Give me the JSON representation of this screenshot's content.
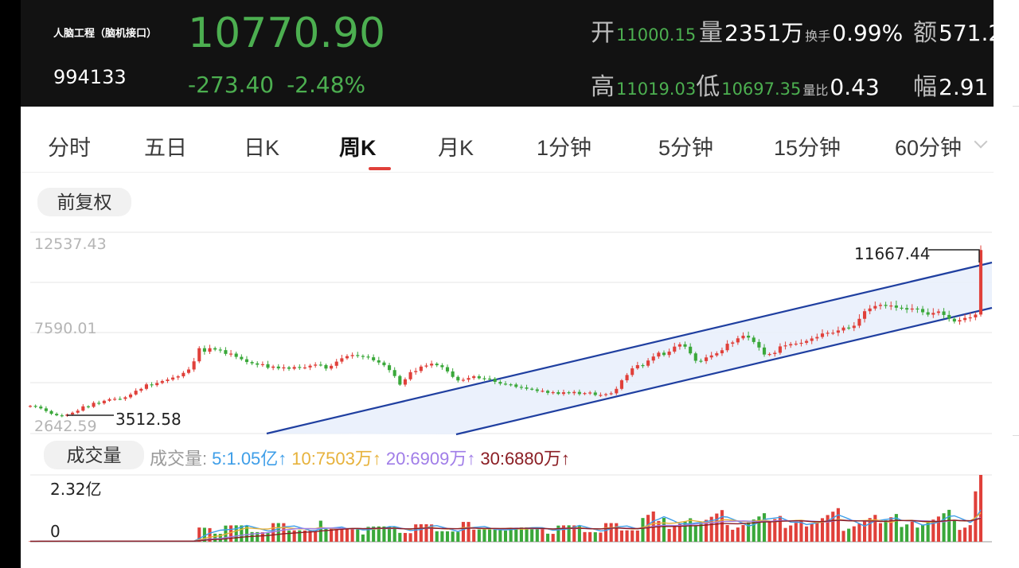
{
  "header": {
    "name": "人脑工程（脑机接口）",
    "code": "994133",
    "price": "10770.90",
    "change": "-273.40",
    "change_pct": "-2.48%",
    "open_label": "开",
    "open_value": "11000.15",
    "volume_label": "量",
    "volume_value": "2351万",
    "turnover_label": "换手",
    "turnover_value": "0.99%",
    "amount_label": "额",
    "amount_value": "571.2",
    "high_label": "高",
    "high_value": "11019.03",
    "low_label": "低",
    "low_value": "10697.35",
    "vol_ratio_label": "量比",
    "vol_ratio_value": "0.43",
    "amplitude_label": "幅",
    "amplitude_value": "2.91"
  },
  "tabs": [
    {
      "label": "分时",
      "active": false
    },
    {
      "label": "五日",
      "active": false
    },
    {
      "label": "日K",
      "active": false
    },
    {
      "label": "周K",
      "active": true
    },
    {
      "label": "月K",
      "active": false
    },
    {
      "label": "1分钟",
      "active": false
    },
    {
      "label": "5分钟",
      "active": false
    },
    {
      "label": "15分钟",
      "active": false
    },
    {
      "label": "60分钟",
      "active": false
    }
  ],
  "adjust_button": "前复权",
  "volume_button": "成交量",
  "volume_legend": {
    "title": "成交量:",
    "ma5": "5:1.05亿↑",
    "ma10": "10:7503万↑",
    "ma20": "20:6909万↑",
    "ma30": "30:6880万↑"
  },
  "colors": {
    "up": "#e0403a",
    "down": "#3aa83a",
    "header_bg": "#121212",
    "channel": "#1f3fa0",
    "ma5": "#3e9ee8",
    "ma10": "#e7b23b",
    "ma20": "#a07de8",
    "ma30": "#8b1e24"
  },
  "chart_data": {
    "type": "candlestick",
    "period": "weekly",
    "y_ticks": [
      "12537.43",
      "7590.01",
      "2642.59"
    ],
    "ylim": [
      2642.59,
      12537.43
    ],
    "annotations": {
      "high": "11667.44",
      "low": "3512.58"
    },
    "candles_close": [
      4003,
      3969,
      3880,
      3751,
      3613,
      3539,
      3512,
      3584,
      3668,
      3768,
      3980,
      3956,
      4154,
      4131,
      4255,
      4334,
      4350,
      4346,
      4425,
      4564,
      4749,
      4841,
      5060,
      5022,
      5128,
      5225,
      5297,
      5397,
      5457,
      5626,
      5792,
      6193,
      6839,
      6667,
      6840,
      6773,
      6744,
      6559,
      6573,
      6413,
      6296,
      6159,
      6095,
      6025,
      6053,
      5876,
      5937,
      5846,
      5898,
      5827,
      5917,
      5887,
      5893,
      5980,
      6033,
      6010,
      5838,
      5974,
      6179,
      6343,
      6449,
      6502,
      6458,
      6428,
      6393,
      6244,
      6136,
      6001,
      5763,
      5471,
      5048,
      5311,
      5662,
      5717,
      5936,
      5988,
      6078,
      6002,
      5907,
      5698,
      5429,
      5254,
      5288,
      5374,
      5460,
      5361,
      5344,
      5343,
      5182,
      5096,
      5063,
      5054,
      4937,
      4908,
      4846,
      4815,
      4735,
      4746,
      4642,
      4677,
      4590,
      4673,
      4627,
      4690,
      4584,
      4632,
      4661,
      4538,
      4540,
      4578,
      4622,
      4841,
      5261,
      5523,
      5848,
      6006,
      5978,
      6232,
      6430,
      6618,
      6505,
      6673,
      6918,
      7030,
      6913,
      6584,
      6221,
      6205,
      6386,
      6484,
      6590,
      6739,
      7059,
      7124,
      7325,
      7454,
      7360,
      7145,
      6873,
      6528,
      6553,
      6613,
      6928,
      6976,
      7042,
      7063,
      7104,
      7197,
      7319,
      7392,
      7562,
      7598,
      7601,
      7711,
      7854,
      7834,
      7945,
      8284,
      8657,
      8791,
      8915,
      8969,
      8917,
      8937,
      8830,
      8813,
      8738,
      8789,
      8767,
      8607,
      8488,
      8575,
      8646,
      8473,
      8287,
      8152,
      8223,
      8327,
      8354,
      8493,
      11667
    ],
    "volume_ma_values": {
      "ma5": "1.05亿",
      "ma10": "7503万",
      "ma20": "6909万",
      "ma30": "6880万"
    },
    "volume_ylabels": [
      "2.32亿",
      "0"
    ],
    "volume_max": 2.32
  }
}
